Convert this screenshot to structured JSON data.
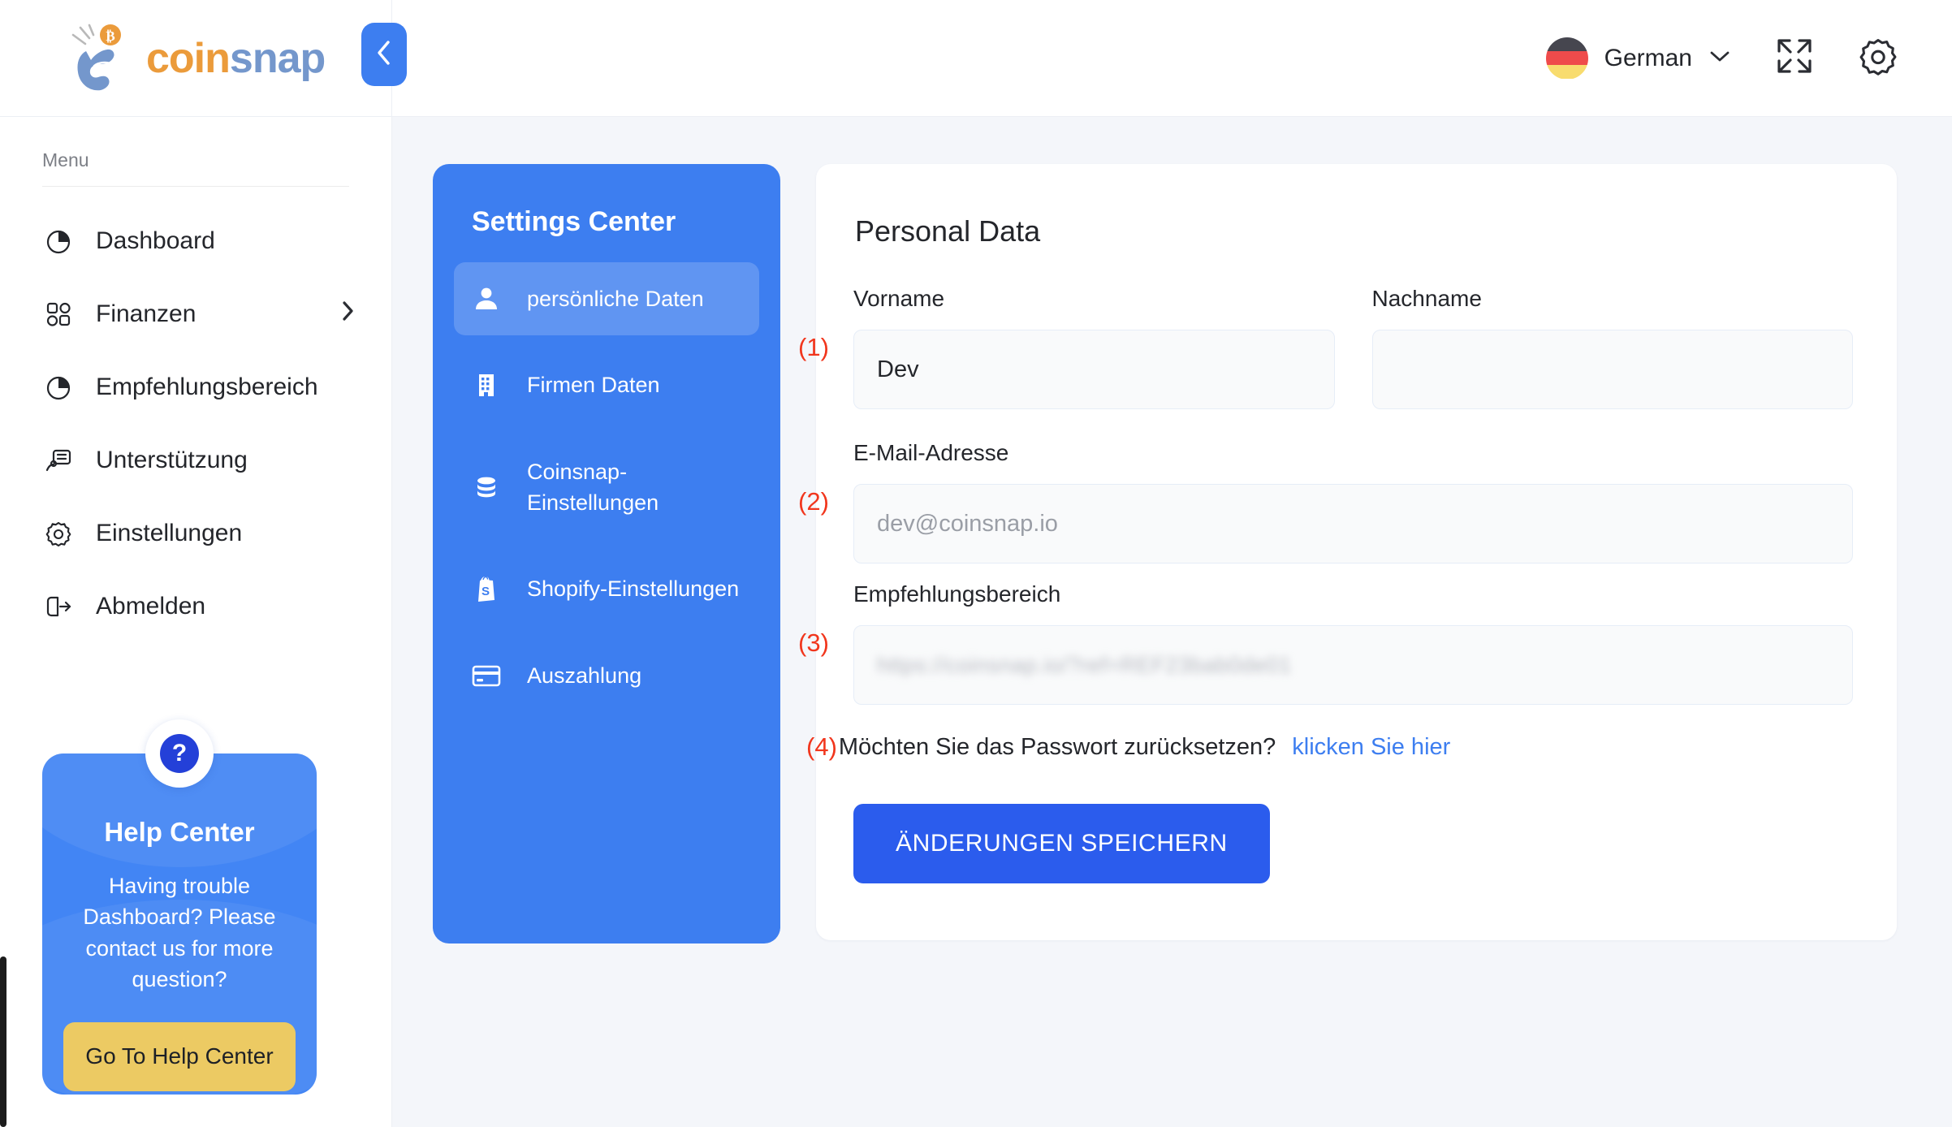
{
  "brand": {
    "name_part1": "coin",
    "name_part2": "snap"
  },
  "sidebar": {
    "menu_label": "Menu",
    "items": [
      {
        "label": "Dashboard",
        "icon": "pie-chart-icon",
        "has_chevron": false
      },
      {
        "label": "Finanzen",
        "icon": "grid-icon",
        "has_chevron": true
      },
      {
        "label": "Empfehlungsbereich",
        "icon": "pie-chart-icon",
        "has_chevron": false
      },
      {
        "label": "Unterstützung",
        "icon": "support-chat-icon",
        "has_chevron": false
      },
      {
        "label": "Einstellungen",
        "icon": "gear-icon",
        "has_chevron": false
      },
      {
        "label": "Abmelden",
        "icon": "logout-icon",
        "has_chevron": false
      }
    ],
    "collapse_icon": "chevron-left-icon",
    "help_card": {
      "badge": "?",
      "title": "Help Center",
      "text": "Having trouble Dashboard? Please contact us for more question?",
      "button": "Go To Help Center"
    }
  },
  "topbar": {
    "language": "German",
    "language_flag": "german-flag-icon",
    "chevron": "chevron-down-icon",
    "fullscreen_icon": "fullscreen-icon",
    "settings_icon": "gear-icon"
  },
  "settings_center": {
    "title": "Settings Center",
    "items": [
      {
        "label": "persönliche Daten",
        "icon": "person-icon",
        "active": true
      },
      {
        "label": "Firmen Daten",
        "icon": "building-icon",
        "active": false
      },
      {
        "label": "Coinsnap-Einstellungen",
        "icon": "coins-icon",
        "active": false
      },
      {
        "label": "Shopify-Einstellungen",
        "icon": "shopify-bag-icon",
        "active": false
      },
      {
        "label": "Auszahlung",
        "icon": "credit-card-icon",
        "active": false
      }
    ]
  },
  "form": {
    "title": "Personal Data",
    "first_name": {
      "label": "Vorname",
      "value": "Dev",
      "marker": "(1)"
    },
    "last_name": {
      "label": "Nachname",
      "value": ""
    },
    "email": {
      "label": "E-Mail-Adresse",
      "placeholder": "dev@coinsnap.io",
      "marker": "(2)"
    },
    "referral": {
      "label": "Empfehlungsbereich",
      "value": "https://coinsnap.io/?ref=REF23bab0de01",
      "marker": "(3)"
    },
    "password_reset": {
      "marker": "(4)",
      "text": "Möchten Sie das Passwort zurücksetzen?",
      "link": "klicken Sie hier"
    },
    "save_button": "ÄNDERUNGEN SPEICHERN"
  },
  "colors": {
    "primary_blue": "#3d7ef0",
    "save_blue": "#2b5ced",
    "marker_red": "#f1361d",
    "help_yellow": "#ecca63",
    "brand_orange": "#eb9b3b",
    "brand_blue": "#7497cc",
    "page_bg": "#f4f6fa"
  }
}
